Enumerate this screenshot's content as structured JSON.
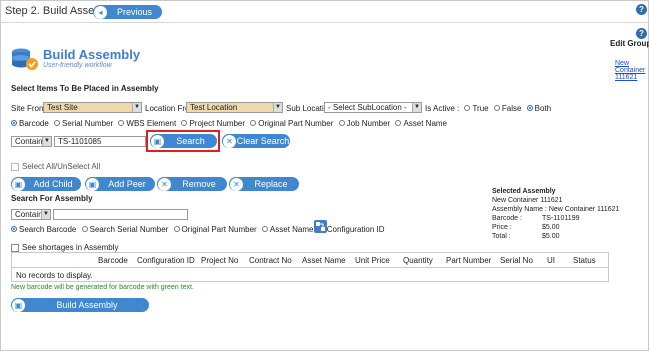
{
  "header": {
    "step_title": "Step 2. Build Assembly",
    "previous_label": "Previous"
  },
  "help_right": {
    "edit_group": "Edit Group",
    "link_line1": "New",
    "link_line2": "Container",
    "link_line3": "111621"
  },
  "logo": {
    "title": "Build Assembly",
    "subtitle": "User-friendly workflow"
  },
  "section_title": "Select Items To Be Placed in Assembly",
  "filters": {
    "site_from_label": "Site From :",
    "site_from_value": "Test Site",
    "location_from_label": "Location From",
    "location_from_value": "Test Location",
    "sub_location_label": "Sub Location",
    "sub_location_value": "- Select SubLocation -",
    "is_active_label": "Is Active :",
    "is_active_options": [
      "True",
      "False",
      "Both"
    ],
    "is_active_selected": "Both"
  },
  "search_types": [
    "Barcode",
    "Serial Number",
    "WBS Element",
    "Project Number",
    "Original Part Number",
    "Job Number",
    "Asset Name"
  ],
  "search": {
    "mode": "Contains",
    "value": "TS-1101085",
    "search_label": "Search",
    "clear_label": "Clear Search"
  },
  "select_all_label": "Select All/UnSelect All",
  "actions": {
    "add_child": "Add Child",
    "add_peer": "Add Peer",
    "remove": "Remove",
    "replace": "Replace"
  },
  "selected_assembly": {
    "heading": "Selected Assembly",
    "name": "New Container 111621",
    "assembly_name_label": "Assembly Name :",
    "assembly_name_value": "New Container 111621",
    "barcode_label": "Barcode :",
    "barcode_value": "TS-1101199",
    "price_label": "Price :",
    "price_value": "$5.00",
    "total_label": "Total :",
    "total_value": "$5.00"
  },
  "assembly_search": {
    "heading": "Search For Assembly",
    "mode": "Contains",
    "value": ""
  },
  "assembly_search_types": [
    "Search Barcode",
    "Search Serial Number",
    "Original Part Number",
    "Asset Name",
    "Configuration ID"
  ],
  "shortages_label": "See shortages in Assembly",
  "table": {
    "columns": [
      "Barcode",
      "Configuration ID",
      "Project No",
      "Contract No",
      "Asset Name",
      "Unit Price",
      "Quantity",
      "Part Number",
      "Serial No",
      "UI",
      "Status"
    ],
    "empty_message": "No records to display."
  },
  "note": "New barcode will be generated for barcode with green text.",
  "build_label": "Build Assembly",
  "colors": {
    "accent": "#3f88cf",
    "highlight": "#e02020",
    "note_green": "#2a8a2a"
  }
}
